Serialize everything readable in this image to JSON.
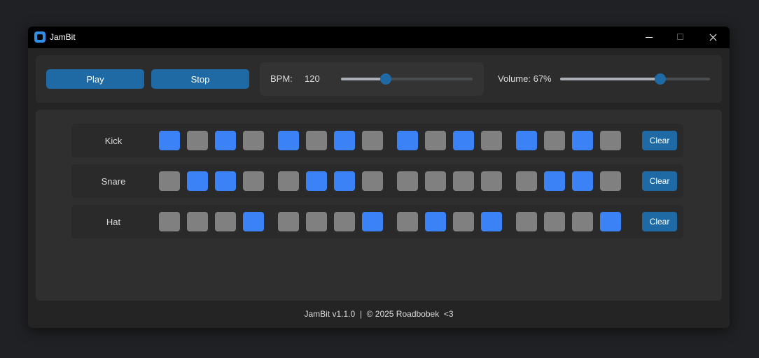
{
  "window": {
    "title": "JamBit"
  },
  "controls": {
    "play_label": "Play",
    "stop_label": "Stop",
    "bpm_label": "BPM:",
    "bpm_value": "120",
    "bpm_slider_fraction": 0.34,
    "volume_label": "Volume: 67%",
    "volume_fraction": 0.67
  },
  "tracks": [
    {
      "name": "Kick",
      "clear_label": "Clear",
      "steps": [
        1,
        0,
        1,
        0,
        1,
        0,
        1,
        0,
        1,
        0,
        1,
        0,
        1,
        0,
        1,
        0
      ]
    },
    {
      "name": "Snare",
      "clear_label": "Clear",
      "steps": [
        0,
        1,
        1,
        0,
        0,
        1,
        1,
        0,
        0,
        0,
        0,
        0,
        0,
        1,
        1,
        0
      ]
    },
    {
      "name": "Hat",
      "clear_label": "Clear",
      "steps": [
        0,
        0,
        0,
        1,
        0,
        0,
        0,
        1,
        0,
        1,
        0,
        1,
        0,
        0,
        0,
        1
      ]
    }
  ],
  "footer": {
    "text": "JamBit v1.1.0  |  © 2025 Roadbobek  <3"
  },
  "colors": {
    "accent": "#1f6aa5",
    "step_on": "#3b82f6",
    "step_off": "#808080"
  }
}
